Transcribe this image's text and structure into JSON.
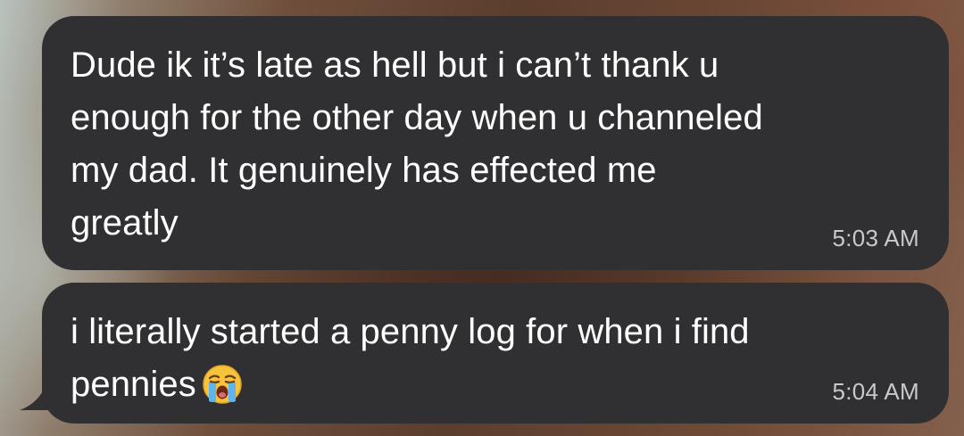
{
  "messages": [
    {
      "lines": [
        "Dude ik it’s late as hell but i can’t thank u",
        "enough for the other day when u channeled",
        "my dad. It genuinely has effected me",
        "greatly"
      ],
      "time": "5:03 AM"
    },
    {
      "lines": [
        "i literally started a penny log for when i find",
        "pennies"
      ],
      "emoji": "loudly-crying-face-emoji",
      "time": "5:04 AM"
    }
  ],
  "colors": {
    "bubble": "#303032",
    "text": "#ffffff",
    "timestamp": "#c9c9cb"
  }
}
